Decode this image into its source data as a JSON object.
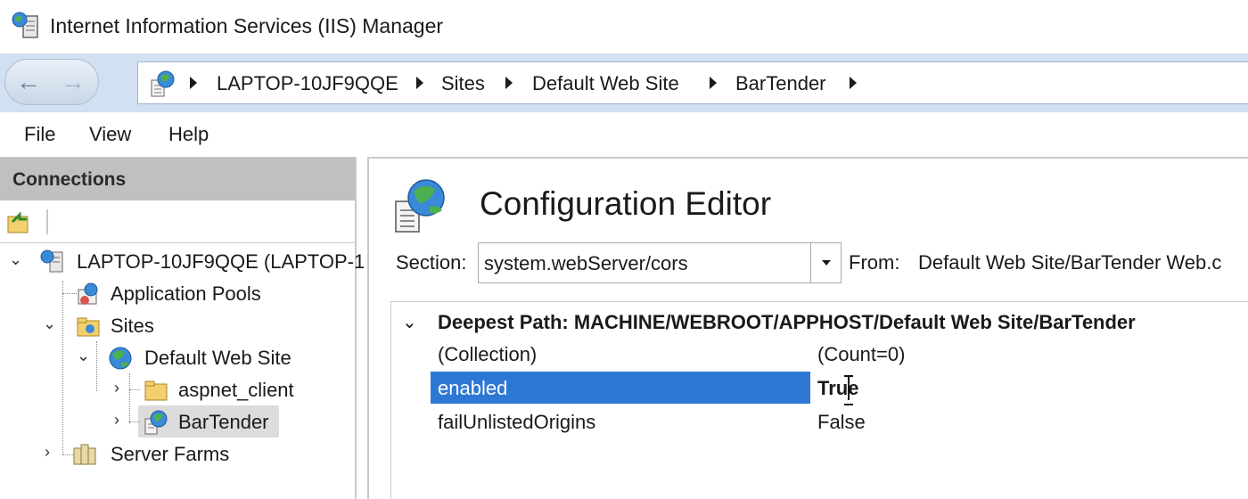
{
  "window": {
    "title": "Internet Information Services (IIS) Manager",
    "icon": "iis-manager-icon"
  },
  "address": {
    "back_icon": "←",
    "forward_icon": "→",
    "crumbs": [
      "LAPTOP-10JF9QQE",
      "Sites",
      "Default Web Site",
      "BarTender"
    ]
  },
  "menu": {
    "items": [
      "File",
      "View",
      "Help"
    ]
  },
  "connections": {
    "title": "Connections",
    "tree": {
      "server": "LAPTOP-10JF9QQE (LAPTOP-1",
      "app_pools": "Application Pools",
      "sites": "Sites",
      "default_site": "Default Web Site",
      "aspnet_client": "aspnet_client",
      "bartender": "BarTender",
      "server_farms": "Server Farms"
    }
  },
  "editor": {
    "title": "Configuration Editor",
    "section_label": "Section:",
    "section_value": "system.webServer/cors",
    "from_label": "From:",
    "from_value": "Default Web Site/BarTender Web.c",
    "group_label": "Deepest Path: MACHINE/WEBROOT/APPHOST/Default Web Site/BarTender",
    "rows": [
      {
        "name": "(Collection)",
        "value": "(Count=0)"
      },
      {
        "name": "enabled",
        "value": "True"
      },
      {
        "name": "failUnlistedOrigins",
        "value": "False"
      }
    ]
  },
  "colors": {
    "selection": "#2d78d4",
    "address_bar": "#d2e1f1",
    "panel_header": "#c0c0c0"
  }
}
